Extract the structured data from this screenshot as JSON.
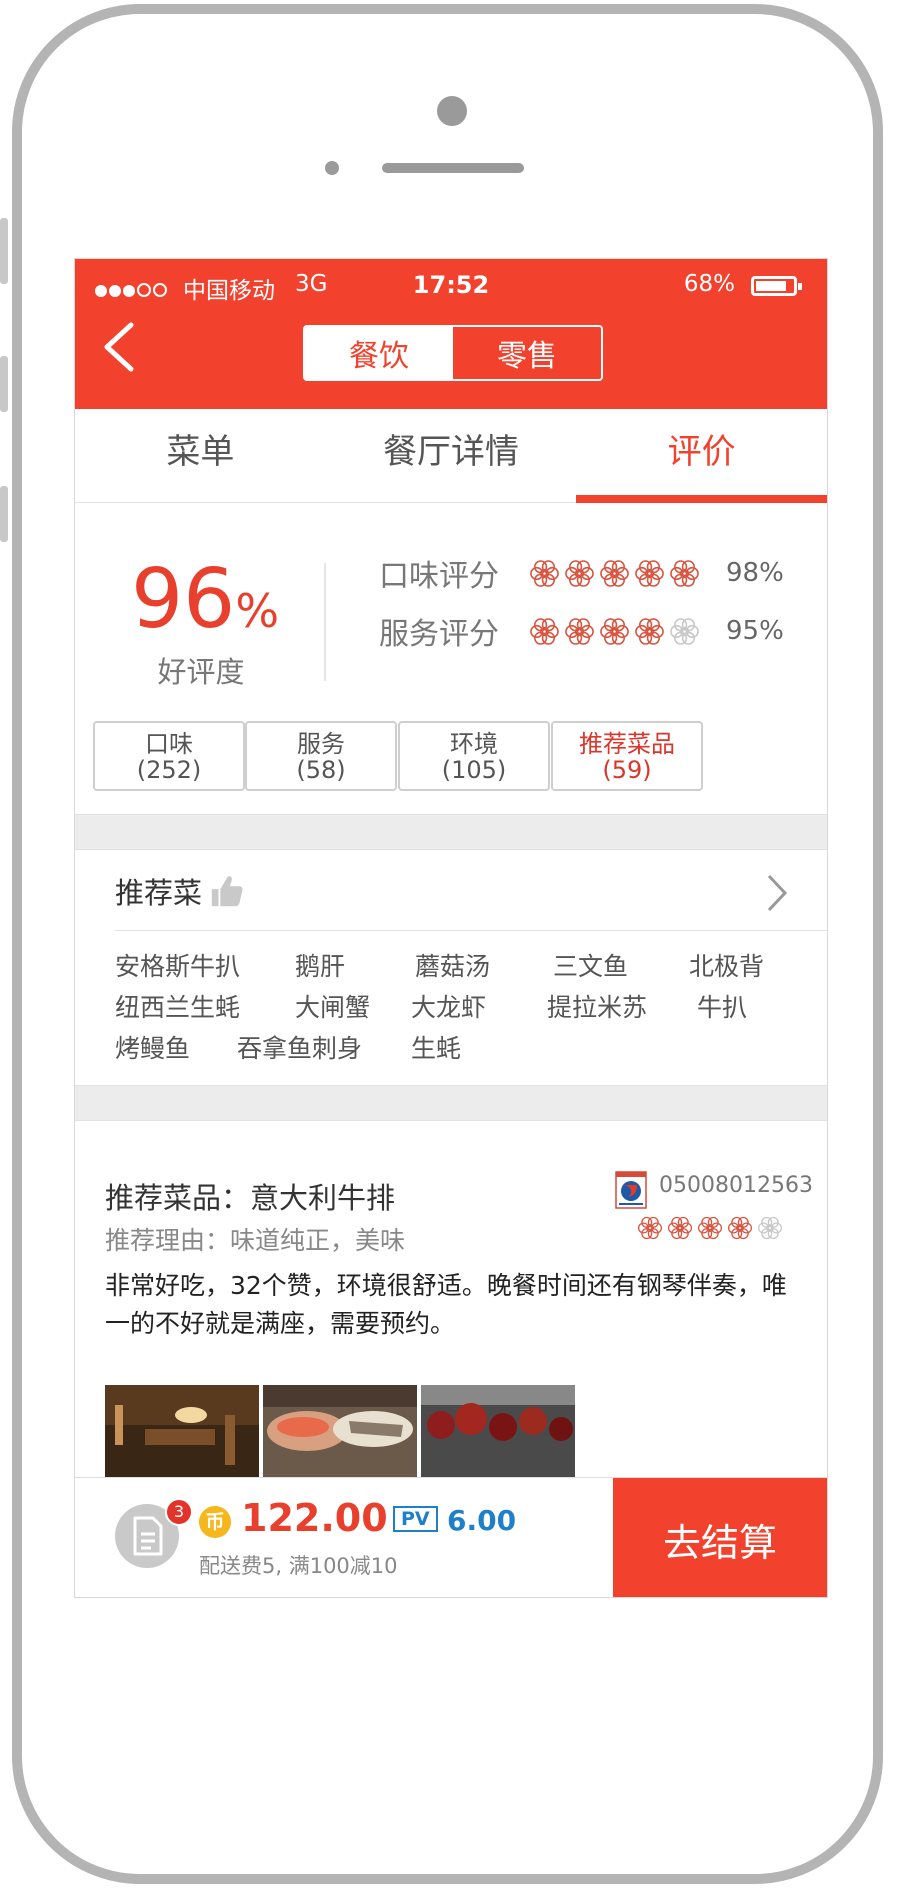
{
  "status_bar": {
    "carrier": "中国移动",
    "network": "3G",
    "time": "17:52",
    "battery": "68%"
  },
  "header": {
    "segments": [
      "餐饮",
      "零售"
    ],
    "active_segment": "餐饮",
    "accent_color": "#f2412c"
  },
  "tabs": [
    {
      "label": "菜单"
    },
    {
      "label": "餐厅详情"
    },
    {
      "label": "评价",
      "active": true
    }
  ],
  "score": {
    "value": "96",
    "unit": "%",
    "label": "好评度",
    "ratings": [
      {
        "label": "口味评分",
        "stars": 5,
        "value": "98%"
      },
      {
        "label": "服务评分",
        "stars": 4,
        "value": "95%"
      }
    ]
  },
  "filters": [
    {
      "label": "口味",
      "count": "(252)"
    },
    {
      "label": "服务",
      "count": "(58)"
    },
    {
      "label": "环境",
      "count": "(105)"
    },
    {
      "label": "推荐菜品",
      "count": "(59)",
      "selected": true
    }
  ],
  "recommended": {
    "title": "推荐菜",
    "dishes": [
      "安格斯牛扒",
      "鹅肝",
      "蘑菇汤",
      "三文鱼",
      "北极背",
      "纽西兰生蚝",
      "大闸蟹",
      "大龙虾",
      "提拉米苏",
      "牛扒",
      "烤鳗鱼",
      "吞拿鱼刺身",
      "生蚝"
    ]
  },
  "review": {
    "title": "推荐菜品：意大利牛排",
    "reason": "推荐理由：味道纯正，美味",
    "user_id": "05008012563",
    "stars": 4,
    "text": "非常好吃，32个赞，环境很舒适。晚餐时间还有钢琴伴奏，唯一的不好就是满座，需要预约。",
    "photos": [
      "restaurant-interior",
      "seafood-platter",
      "grilled-meat"
    ]
  },
  "cart": {
    "badge": "3",
    "coin_symbol": "币",
    "price": "122.00",
    "pv_label": "PV",
    "pv_value": "6.00",
    "delivery_note": "配送费5, 满100减10",
    "checkout_label": "去结算"
  }
}
